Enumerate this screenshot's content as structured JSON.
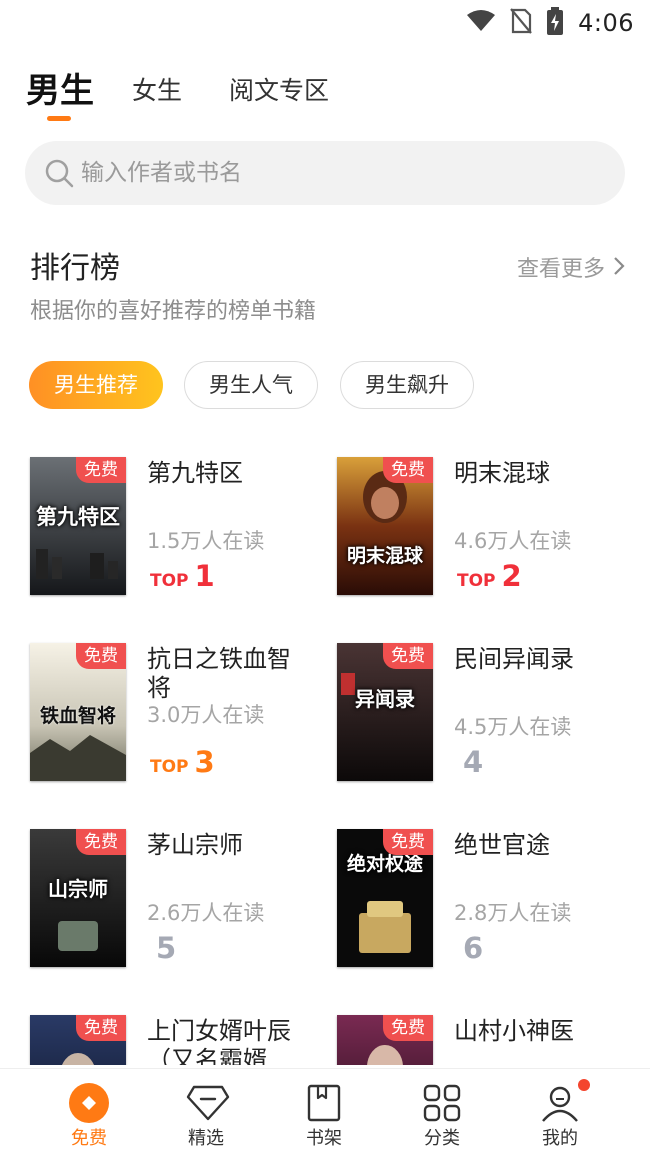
{
  "status_bar": {
    "time": "4:06"
  },
  "gender_tabs": [
    {
      "label": "男生",
      "active": true
    },
    {
      "label": "女生",
      "active": false
    },
    {
      "label": "阅文专区",
      "active": false
    }
  ],
  "search": {
    "placeholder": "输入作者或书名"
  },
  "ranking": {
    "title": "排行榜",
    "more_label": "查看更多",
    "subtitle": "根据你的喜好推荐的榜单书籍",
    "filters": [
      {
        "label": "男生推荐",
        "active": true
      },
      {
        "label": "男生人气",
        "active": false
      },
      {
        "label": "男生飙升",
        "active": false
      }
    ]
  },
  "books": [
    {
      "name": "第九特区",
      "readers": "1.5万人在读",
      "top_label": "TOP",
      "rank": "1",
      "rank_color": "#f0303a",
      "badge": "免费",
      "cover_text": "第九特区",
      "cover_from": "#5b5f63",
      "cover_to": "#1a1c1e"
    },
    {
      "name": "明末混球",
      "readers": "4.6万人在读",
      "top_label": "TOP",
      "rank": "2",
      "rank_color": "#f0303a",
      "badge": "免费",
      "cover_text": "明末混球",
      "cover_from": "#c98a2a",
      "cover_to": "#3a1208"
    },
    {
      "name": "抗日之铁血智将",
      "readers": "3.0万人在读",
      "top_label": "TOP",
      "rank": "3",
      "rank_color": "#ff7a14",
      "badge": "免费",
      "cover_text": "铁血智将",
      "cover_from": "#f4efe2",
      "cover_to": "#8a8a78"
    },
    {
      "name": "民间异闻录",
      "readers": "4.5万人在读",
      "top_label": "",
      "rank": "4",
      "rank_color": "#a5a9b4",
      "badge": "免费",
      "cover_text": "异闻录",
      "cover_from": "#3a2a2a",
      "cover_to": "#0c0a0a"
    },
    {
      "name": "茅山宗师",
      "readers": "2.6万人在读",
      "top_label": "",
      "rank": "5",
      "rank_color": "#a5a9b4",
      "badge": "免费",
      "cover_text": "山宗师",
      "cover_from": "#2e2e2e",
      "cover_to": "#0a0a0a"
    },
    {
      "name": "绝世官途",
      "readers": "2.8万人在读",
      "top_label": "",
      "rank": "6",
      "rank_color": "#a5a9b4",
      "badge": "免费",
      "cover_text": "绝对权途",
      "cover_from": "#1c1c1c",
      "cover_to": "#000000"
    },
    {
      "name": "上门女婿叶辰（又名霸婿...",
      "readers": "",
      "top_label": "",
      "rank": "",
      "rank_color": "#a5a9b4",
      "badge": "免费",
      "cover_text": "",
      "cover_from": "#22325a",
      "cover_to": "#0a1020"
    },
    {
      "name": "山村小神医",
      "readers": "",
      "top_label": "",
      "rank": "",
      "rank_color": "#a5a9b4",
      "badge": "免费",
      "cover_text": "",
      "cover_from": "#6a2a4a",
      "cover_to": "#1a0a14"
    }
  ],
  "bottom_nav": [
    {
      "label": "免费",
      "icon": "free-diamond-icon",
      "active": true
    },
    {
      "label": "精选",
      "icon": "gem-icon",
      "active": false
    },
    {
      "label": "书架",
      "icon": "bookshelf-icon",
      "active": false
    },
    {
      "label": "分类",
      "icon": "category-grid-icon",
      "active": false
    },
    {
      "label": "我的",
      "icon": "profile-icon",
      "active": false,
      "notification_dot": true
    }
  ],
  "colors": {
    "accent": "#ff7a14",
    "free_badge": "#f0504f",
    "top_red": "#f0303a"
  }
}
